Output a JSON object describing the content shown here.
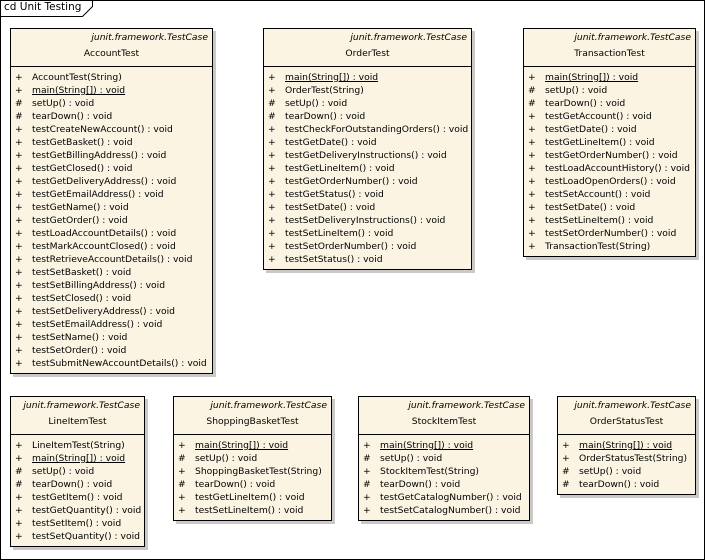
{
  "frame": {
    "title": "cd Unit Testing"
  },
  "classes": [
    {
      "id": "account-test",
      "stereotype": "junit.framework.TestCase",
      "name": "AccountTest",
      "operations": [
        {
          "vis": "+",
          "sig": "AccountTest(String)",
          "static": false
        },
        {
          "vis": "+",
          "sig": "main(String[]) : void",
          "static": true
        },
        {
          "vis": "#",
          "sig": "setUp() : void",
          "static": false
        },
        {
          "vis": "#",
          "sig": "tearDown() : void",
          "static": false
        },
        {
          "vis": "+",
          "sig": "testCreateNewAccount() : void",
          "static": false
        },
        {
          "vis": "+",
          "sig": "testGetBasket() : void",
          "static": false
        },
        {
          "vis": "+",
          "sig": "testGetBillingAddress() : void",
          "static": false
        },
        {
          "vis": "+",
          "sig": "testGetClosed() : void",
          "static": false
        },
        {
          "vis": "+",
          "sig": "testGetDeliveryAddress() : void",
          "static": false
        },
        {
          "vis": "+",
          "sig": "testGetEmailAddress() : void",
          "static": false
        },
        {
          "vis": "+",
          "sig": "testGetName() : void",
          "static": false
        },
        {
          "vis": "+",
          "sig": "testGetOrder() : void",
          "static": false
        },
        {
          "vis": "+",
          "sig": "testLoadAccountDetails() : void",
          "static": false
        },
        {
          "vis": "+",
          "sig": "testMarkAccountClosed() : void",
          "static": false
        },
        {
          "vis": "+",
          "sig": "testRetrieveAccountDetails() : void",
          "static": false
        },
        {
          "vis": "+",
          "sig": "testSetBasket() : void",
          "static": false
        },
        {
          "vis": "+",
          "sig": "testSetBillingAddress() : void",
          "static": false
        },
        {
          "vis": "+",
          "sig": "testSetClosed() : void",
          "static": false
        },
        {
          "vis": "+",
          "sig": "testSetDeliveryAddress() : void",
          "static": false
        },
        {
          "vis": "+",
          "sig": "testSetEmailAddress() : void",
          "static": false
        },
        {
          "vis": "+",
          "sig": "testSetName() : void",
          "static": false
        },
        {
          "vis": "+",
          "sig": "testSetOrder() : void",
          "static": false
        },
        {
          "vis": "+",
          "sig": "testSubmitNewAccountDetails() : void",
          "static": false
        }
      ]
    },
    {
      "id": "order-test",
      "stereotype": "junit.framework.TestCase",
      "name": "OrderTest",
      "operations": [
        {
          "vis": "+",
          "sig": "main(String[]) : void",
          "static": true
        },
        {
          "vis": "+",
          "sig": "OrderTest(String)",
          "static": false
        },
        {
          "vis": "#",
          "sig": "setUp() : void",
          "static": false
        },
        {
          "vis": "#",
          "sig": "tearDown() : void",
          "static": false
        },
        {
          "vis": "+",
          "sig": "testCheckForOutstandingOrders() : void",
          "static": false
        },
        {
          "vis": "+",
          "sig": "testGetDate() : void",
          "static": false
        },
        {
          "vis": "+",
          "sig": "testGetDeliveryInstructions() : void",
          "static": false
        },
        {
          "vis": "+",
          "sig": "testGetLineItem() : void",
          "static": false
        },
        {
          "vis": "+",
          "sig": "testGetOrderNumber() : void",
          "static": false
        },
        {
          "vis": "+",
          "sig": "testGetStatus() : void",
          "static": false
        },
        {
          "vis": "+",
          "sig": "testSetDate() : void",
          "static": false
        },
        {
          "vis": "+",
          "sig": "testSetDeliveryInstructions() : void",
          "static": false
        },
        {
          "vis": "+",
          "sig": "testSetLineItem() : void",
          "static": false
        },
        {
          "vis": "+",
          "sig": "testSetOrderNumber() : void",
          "static": false
        },
        {
          "vis": "+",
          "sig": "testSetStatus() : void",
          "static": false
        }
      ]
    },
    {
      "id": "transaction-test",
      "stereotype": "junit.framework.TestCase",
      "name": "TransactionTest",
      "operations": [
        {
          "vis": "+",
          "sig": "main(String[]) : void",
          "static": true
        },
        {
          "vis": "#",
          "sig": "setUp() : void",
          "static": false
        },
        {
          "vis": "#",
          "sig": "tearDown() : void",
          "static": false
        },
        {
          "vis": "+",
          "sig": "testGetAccount() : void",
          "static": false
        },
        {
          "vis": "+",
          "sig": "testGetDate() : void",
          "static": false
        },
        {
          "vis": "+",
          "sig": "testGetLineItem() : void",
          "static": false
        },
        {
          "vis": "+",
          "sig": "testGetOrderNumber() : void",
          "static": false
        },
        {
          "vis": "+",
          "sig": "testLoadAccountHistory() : void",
          "static": false
        },
        {
          "vis": "+",
          "sig": "testLoadOpenOrders() : void",
          "static": false
        },
        {
          "vis": "+",
          "sig": "testSetAccount() : void",
          "static": false
        },
        {
          "vis": "+",
          "sig": "testSetDate() : void",
          "static": false
        },
        {
          "vis": "+",
          "sig": "testSetLineItem() : void",
          "static": false
        },
        {
          "vis": "+",
          "sig": "testSetOrderNumber() : void",
          "static": false
        },
        {
          "vis": "+",
          "sig": "TransactionTest(String)",
          "static": false
        }
      ]
    },
    {
      "id": "line-item-test",
      "stereotype": "junit.framework.TestCase",
      "name": "LineItemTest",
      "operations": [
        {
          "vis": "+",
          "sig": "LineItemTest(String)",
          "static": false
        },
        {
          "vis": "+",
          "sig": "main(String[]) : void",
          "static": true
        },
        {
          "vis": "#",
          "sig": "setUp() : void",
          "static": false
        },
        {
          "vis": "#",
          "sig": "tearDown() : void",
          "static": false
        },
        {
          "vis": "+",
          "sig": "testGetItem() : void",
          "static": false
        },
        {
          "vis": "+",
          "sig": "testGetQuantity() : void",
          "static": false
        },
        {
          "vis": "+",
          "sig": "testSetItem() : void",
          "static": false
        },
        {
          "vis": "+",
          "sig": "testSetQuantity() : void",
          "static": false
        }
      ]
    },
    {
      "id": "shopping-basket-test",
      "stereotype": "junit.framework.TestCase",
      "name": "ShoppingBasketTest",
      "operations": [
        {
          "vis": "+",
          "sig": "main(String[]) : void",
          "static": true
        },
        {
          "vis": "#",
          "sig": "setUp() : void",
          "static": false
        },
        {
          "vis": "+",
          "sig": "ShoppingBasketTest(String)",
          "static": false
        },
        {
          "vis": "#",
          "sig": "tearDown() : void",
          "static": false
        },
        {
          "vis": "+",
          "sig": "testGetLineItem() : void",
          "static": false
        },
        {
          "vis": "+",
          "sig": "testSetLineItem() : void",
          "static": false
        }
      ]
    },
    {
      "id": "stock-item-test",
      "stereotype": "junit.framework.TestCase",
      "name": "StockItemTest",
      "operations": [
        {
          "vis": "+",
          "sig": "main(String[]) : void",
          "static": true
        },
        {
          "vis": "#",
          "sig": "setUp() : void",
          "static": false
        },
        {
          "vis": "+",
          "sig": "StockItemTest(String)",
          "static": false
        },
        {
          "vis": "#",
          "sig": "tearDown() : void",
          "static": false
        },
        {
          "vis": "+",
          "sig": "testGetCatalogNumber() : void",
          "static": false
        },
        {
          "vis": "+",
          "sig": "testSetCatalogNumber() : void",
          "static": false
        }
      ]
    },
    {
      "id": "order-status-test",
      "stereotype": "junit.framework.TestCase",
      "name": "OrderStatusTest",
      "operations": [
        {
          "vis": "+",
          "sig": "main(String[]) : void",
          "static": true
        },
        {
          "vis": "+",
          "sig": "OrderStatusTest(String)",
          "static": false
        },
        {
          "vis": "#",
          "sig": "setUp() : void",
          "static": false
        },
        {
          "vis": "#",
          "sig": "tearDown() : void",
          "static": false
        }
      ]
    }
  ]
}
